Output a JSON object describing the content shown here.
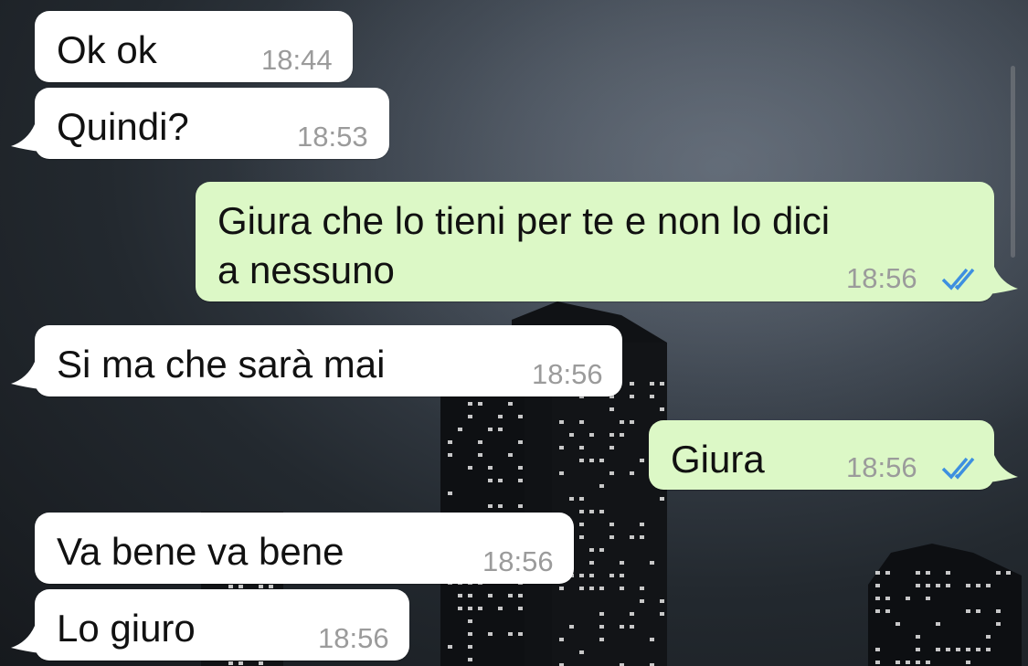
{
  "chat": {
    "messages": [
      {
        "direction": "incoming",
        "text": "Ok ok",
        "time": "18:44"
      },
      {
        "direction": "incoming",
        "text": "Quindi?",
        "time": "18:53"
      },
      {
        "direction": "outgoing",
        "text": "Giura che lo tieni per te e non lo dici\na nessuno",
        "time": "18:56",
        "status": "read"
      },
      {
        "direction": "incoming",
        "text": "Si ma che sarà mai",
        "time": "18:56"
      },
      {
        "direction": "outgoing",
        "text": "Giura",
        "time": "18:56",
        "status": "read"
      },
      {
        "direction": "incoming",
        "text": "Va bene va bene",
        "time": "18:56"
      },
      {
        "direction": "incoming",
        "text": "Lo giuro",
        "time": "18:56"
      }
    ]
  },
  "colors": {
    "incoming_bubble": "#ffffff",
    "outgoing_bubble": "#dcf8c6",
    "read_ticks": "#3d8fe0",
    "timestamp": "#9b9b9b"
  },
  "icons": {
    "read_receipt": "double-check-icon"
  }
}
